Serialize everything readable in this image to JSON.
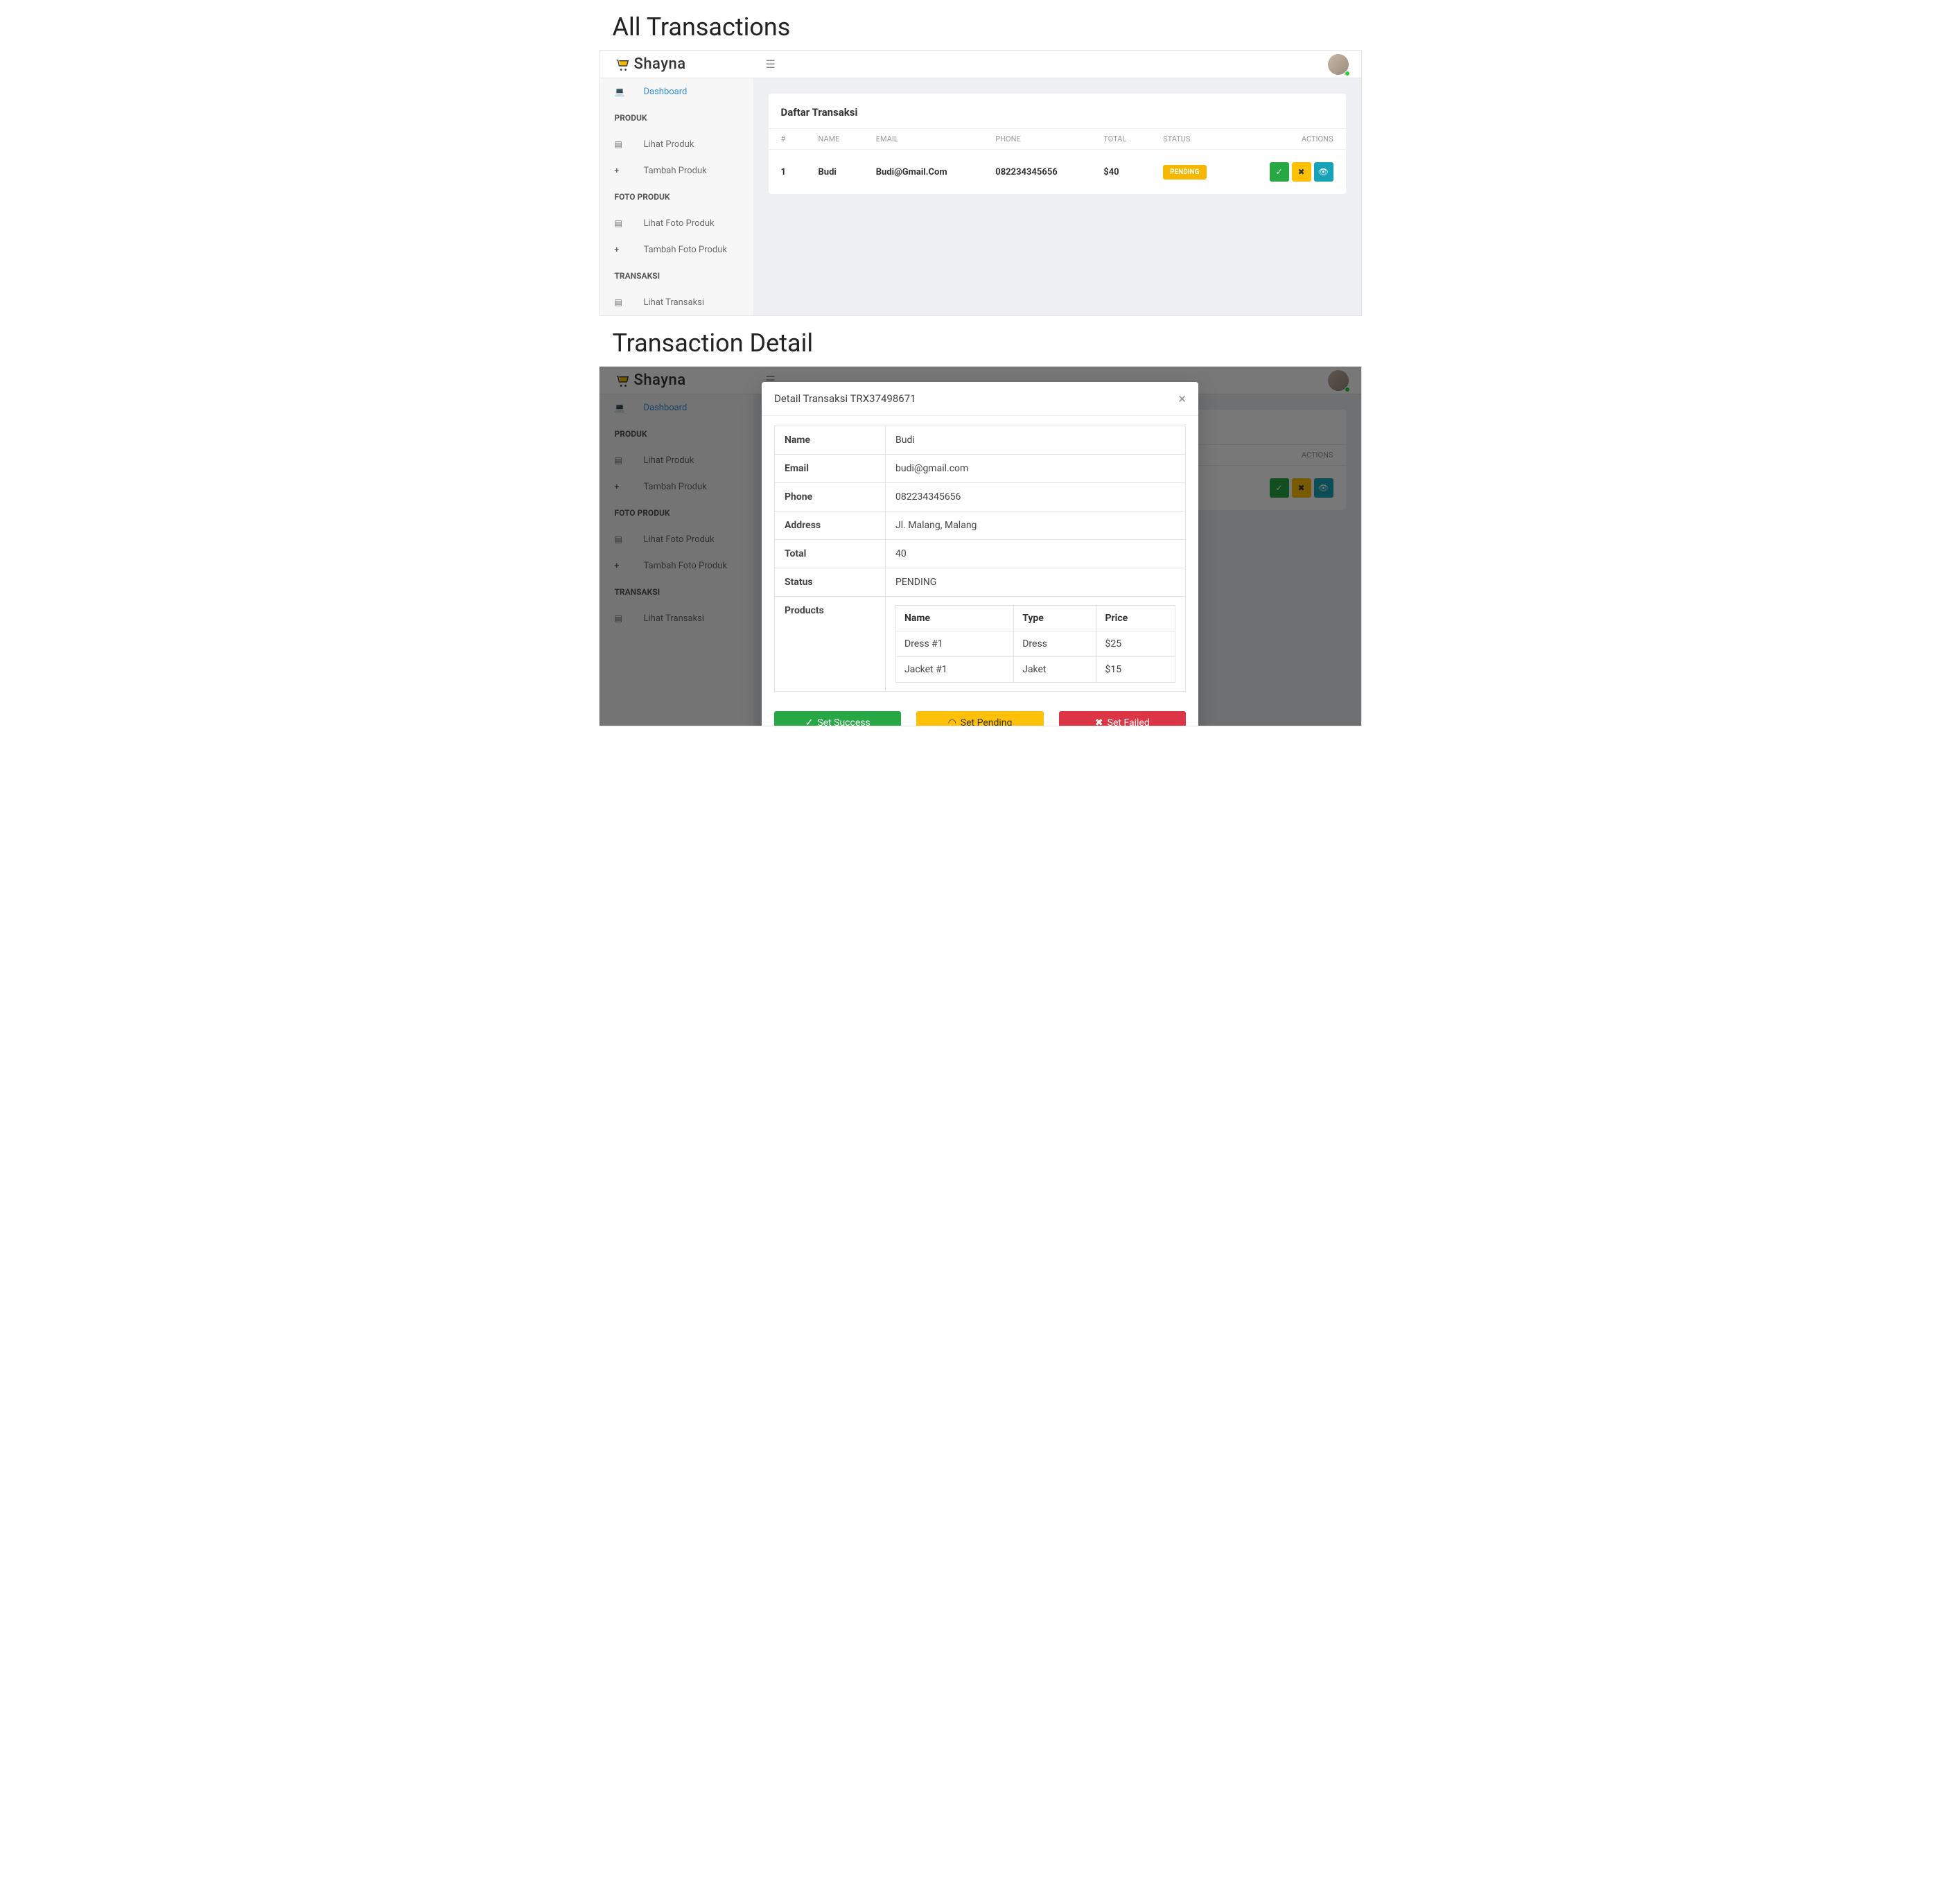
{
  "section1_title": "All Transactions",
  "section2_title": "Transaction Detail",
  "brand": {
    "name": "Shayna"
  },
  "sidebar": {
    "dashboard": "Dashboard",
    "heading_produk": "PRODUK",
    "lihat_produk": "Lihat Produk",
    "tambah_produk": "Tambah Produk",
    "heading_foto": "FOTO PRODUK",
    "lihat_foto": "Lihat Foto Produk",
    "tambah_foto": "Tambah Foto Produk",
    "heading_transaksi": "TRANSAKSI",
    "lihat_transaksi": "Lihat Transaksi"
  },
  "list": {
    "card_title": "Daftar Transaksi",
    "cols": {
      "idx": "#",
      "name": "NAME",
      "email": "EMAIL",
      "phone": "PHONE",
      "total": "TOTAL",
      "status": "STATUS",
      "actions": "ACTIONS"
    },
    "rows": [
      {
        "idx": "1",
        "name": "Budi",
        "email": "Budi@Gmail.Com",
        "phone": "082234345656",
        "total": "$40",
        "status": "PENDING"
      }
    ]
  },
  "detail": {
    "title_prefix": "Detail Transaksi ",
    "trx_id": "TRX37498671",
    "labels": {
      "name": "Name",
      "email": "Email",
      "phone": "Phone",
      "address": "Address",
      "total": "Total",
      "status": "Status",
      "products": "Products"
    },
    "values": {
      "name": "Budi",
      "email": "budi@gmail.com",
      "phone": "082234345656",
      "address": "Jl. Malang, Malang",
      "total": "40",
      "status": "PENDING"
    },
    "products": {
      "cols": {
        "name": "Name",
        "type": "Type",
        "price": "Price"
      },
      "rows": [
        {
          "name": "Dress #1",
          "type": "Dress",
          "price": "$25"
        },
        {
          "name": "Jacket #1",
          "type": "Jaket",
          "price": "$15"
        }
      ]
    },
    "buttons": {
      "success": "Set Success",
      "pending": "Set Pending",
      "failed": "Set Failed"
    }
  }
}
